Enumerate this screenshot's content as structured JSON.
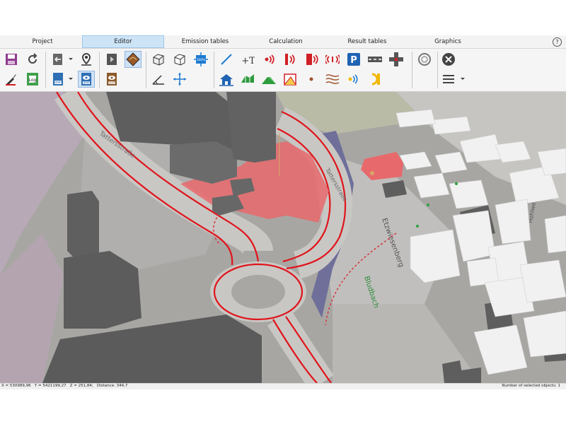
{
  "menu": {
    "tabs": [
      "Project",
      "Editor",
      "Emission tables",
      "Calculation",
      "Result tables",
      "Graphics"
    ],
    "active": "Editor",
    "help": "?"
  },
  "toolbar": {
    "log_label": "Log",
    "bmp_label": "BMP",
    "bmp_view_label": "BMP",
    "dgm_label": "DGM",
    "zoom_label": "100%",
    "text_tool_label": "+T",
    "parking_label": "P"
  },
  "map": {
    "street_label_1": "Tattersstraße",
    "street_label_2": "Etzwiesenberg",
    "creek_label": "Bludbach",
    "street_label_3": "Hohlweg"
  },
  "status": {
    "coords": "X = 530989,96   Y = 5421199,27   Z = 251,84;   Distance: 344,7",
    "selection": "Number of selected objects: 1"
  },
  "colors": {
    "road_red": "#e0141b",
    "building_red": "#e8696c",
    "building_dark": "#5c5c5c",
    "building_white": "#f1f1f1",
    "menu_active": "#cde4f7"
  }
}
